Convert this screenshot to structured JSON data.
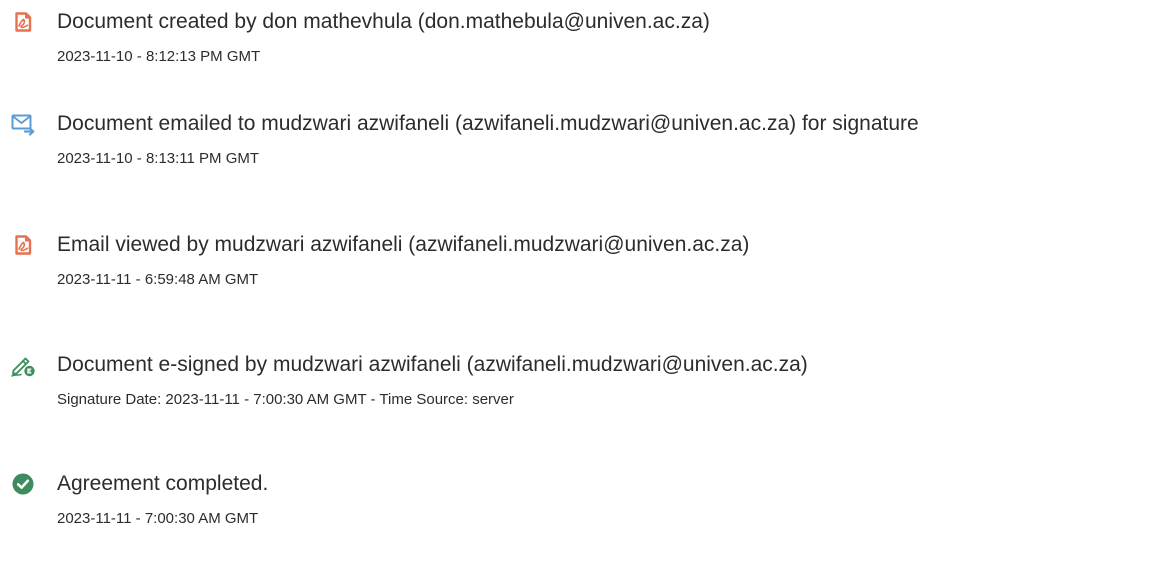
{
  "events": [
    {
      "icon": "document-created-icon",
      "title": "Document created by don mathevhula (don.mathebula@univen.ac.za)",
      "meta": "2023-11-10 - 8:12:13 PM GMT"
    },
    {
      "icon": "email-sent-icon",
      "title": "Document emailed to mudzwari azwifaneli (azwifaneli.mudzwari@univen.ac.za) for signature",
      "meta": "2023-11-10 - 8:13:11 PM GMT"
    },
    {
      "icon": "document-viewed-icon",
      "title": "Email viewed by mudzwari azwifaneli (azwifaneli.mudzwari@univen.ac.za)",
      "meta": "2023-11-11 - 6:59:48 AM GMT"
    },
    {
      "icon": "e-sign-pen-icon",
      "title": "Document e-signed by mudzwari azwifaneli (azwifaneli.mudzwari@univen.ac.za)",
      "meta": "Signature Date: 2023-11-11 - 7:00:30 AM GMT - Time Source: server"
    },
    {
      "icon": "checkmark-circle-icon",
      "title": "Agreement completed.",
      "meta": "2023-11-11 - 7:00:30 AM GMT"
    }
  ],
  "colors": {
    "document_icon": "#e8704f",
    "email_icon": "#5b9bd5",
    "sign_icon": "#3f8e5f",
    "complete_icon": "#3d8b5e",
    "text": "#2c2c2c"
  }
}
